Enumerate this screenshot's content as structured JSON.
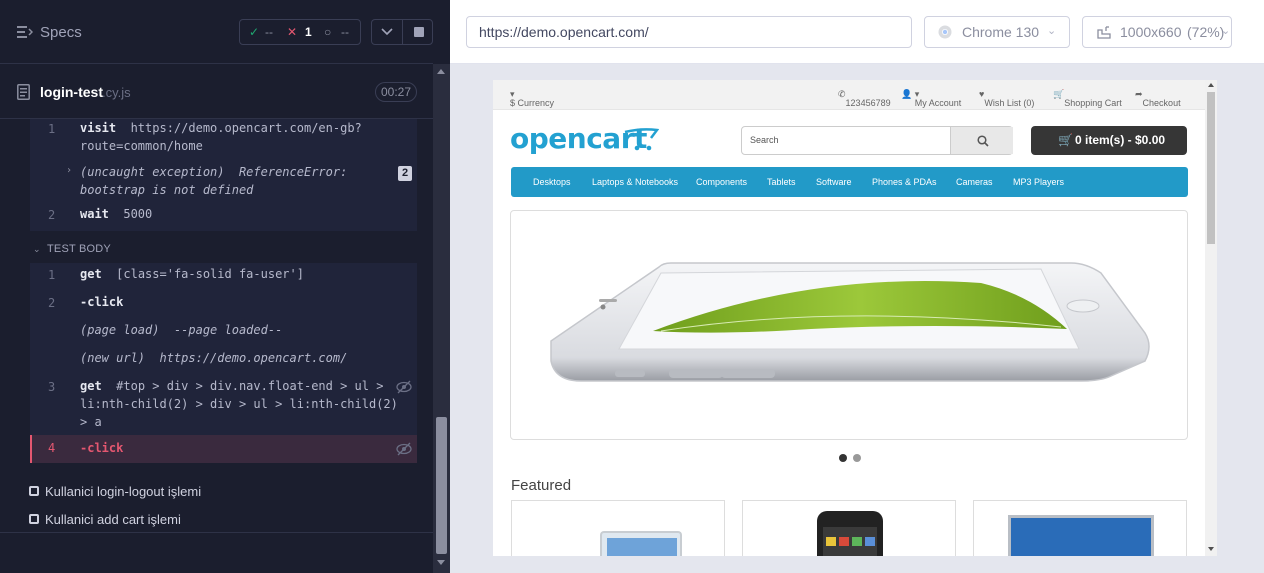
{
  "reporter": {
    "specs_label": "Specs",
    "stats": {
      "passed": "--",
      "failed": "1",
      "pending": "--",
      "colors": {
        "passed": "#1fa971",
        "failed": "#e45770",
        "pending": "#8b8e9f"
      }
    },
    "spec": {
      "name": "login-test",
      "ext": ".cy.js",
      "duration": "00:27"
    },
    "before_commands": [
      {
        "num": "1",
        "name": "visit",
        "msg_lines": [
          "https://demo.opencart.com/en-gb?",
          "route=common/home"
        ]
      },
      {
        "num": "",
        "name": "(uncaught exception)",
        "msg_lines": [
          "ReferenceError:",
          "bootstrap is not defined"
        ],
        "badge": "2"
      },
      {
        "num": "2",
        "name": "wait",
        "msg_lines": [
          "5000"
        ]
      }
    ],
    "test_body_label": "TEST BODY",
    "body_commands": [
      {
        "num": "1",
        "name": "get",
        "msg_lines": [
          "[class='fa-solid fa-user']"
        ]
      },
      {
        "num": "2",
        "name": "-click",
        "msg_lines": []
      },
      {
        "num": "",
        "name": "(page load)",
        "msg_lines": [
          "--page loaded--"
        ]
      },
      {
        "num": "",
        "name": "(new url)",
        "msg_lines": [
          "https://demo.opencart.com/"
        ]
      },
      {
        "num": "3",
        "name": "get",
        "msg_lines": [
          "#top > div > div.nav.float-end > ul >",
          "li:nth-child(2) > div > ul > li:nth-child(2)",
          "> a"
        ]
      },
      {
        "num": "4",
        "name": "-click",
        "msg_lines": [],
        "state": "failed"
      }
    ],
    "suites": [
      "Kullanici login-logout işlemi",
      "Kullanici add cart işlemi"
    ]
  },
  "aut": {
    "url": "https://demo.opencart.com/",
    "browser": "Chrome 130",
    "viewport": "1000x660",
    "scale": "(72%)",
    "site": {
      "currency": "$ Currency",
      "phone": "123456789",
      "account": "My Account",
      "wishlist": "Wish List (0)",
      "cart_link": "Shopping Cart",
      "checkout": "Checkout",
      "logo": "opencart",
      "search_placeholder": "Search",
      "cart_button": "0 item(s) - $0.00",
      "menu": [
        "Desktops",
        "Laptops & Notebooks",
        "Components",
        "Tablets",
        "Software",
        "Phones & PDAs",
        "Cameras",
        "MP3 Players"
      ],
      "featured": "Featured",
      "accent": "#229ac8"
    }
  }
}
